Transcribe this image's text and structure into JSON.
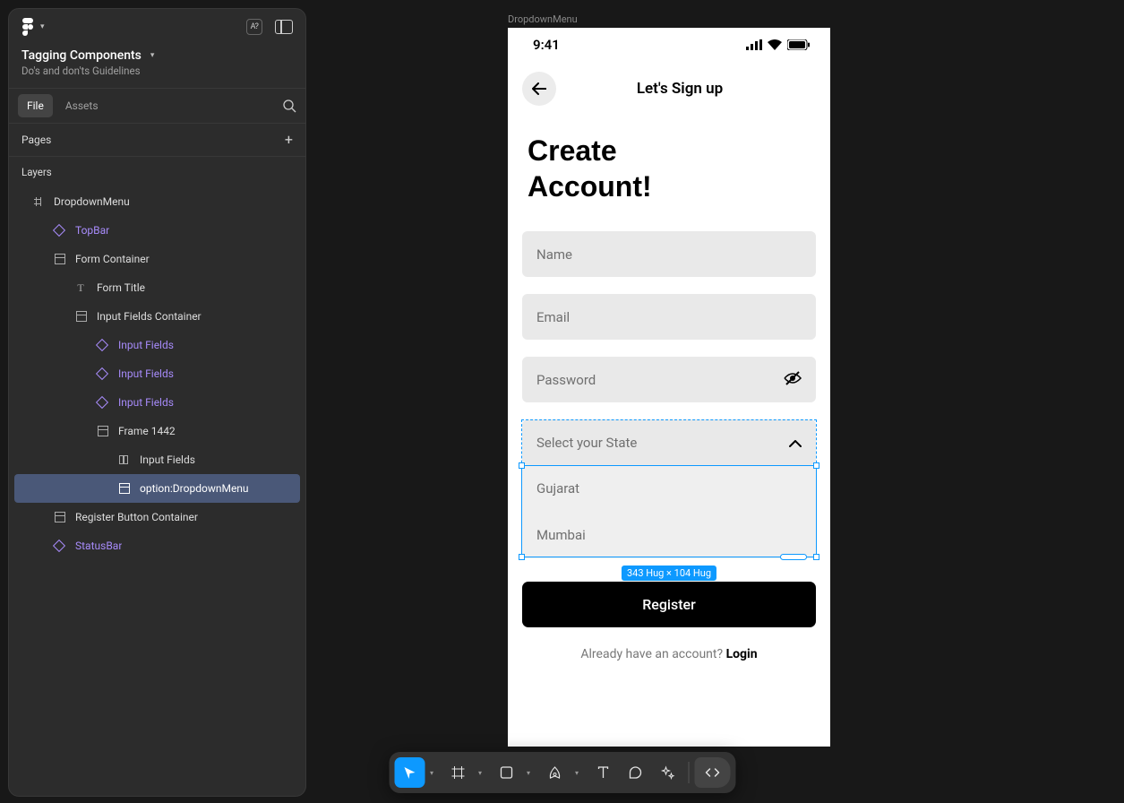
{
  "project": {
    "title": "Tagging Components",
    "subtitle": "Do's and don'ts Guidelines"
  },
  "tabs": {
    "file": "File",
    "assets": "Assets"
  },
  "pages_label": "Pages",
  "layers_label": "Layers",
  "layers": {
    "root": "DropdownMenu",
    "topbar": "TopBar",
    "form_container": "Form Container",
    "form_title": "Form Title",
    "input_fields_container": "Input Fields Container",
    "input_fields_1": "Input Fields",
    "input_fields_2": "Input Fields",
    "input_fields_3": "Input Fields",
    "frame_1442": "Frame 1442",
    "input_fields_4": "Input Fields",
    "option_dropdown": "option:DropdownMenu",
    "register_container": "Register Button Container",
    "statusbar": "StatusBar"
  },
  "canvas": {
    "frame_label": "DropdownMenu",
    "selection_size": "343 Hug × 104 Hug"
  },
  "phone": {
    "time": "9:41",
    "topbar_title": "Let's Sign up",
    "form_title_l1": "Create",
    "form_title_l2": "Account!",
    "name_ph": "Name",
    "email_ph": "Email",
    "password_ph": "Password",
    "state_ph": "Select your State",
    "options": [
      "Gujarat",
      "Mumbai"
    ],
    "register": "Register",
    "already": "Already have an account? ",
    "login": "Login"
  }
}
